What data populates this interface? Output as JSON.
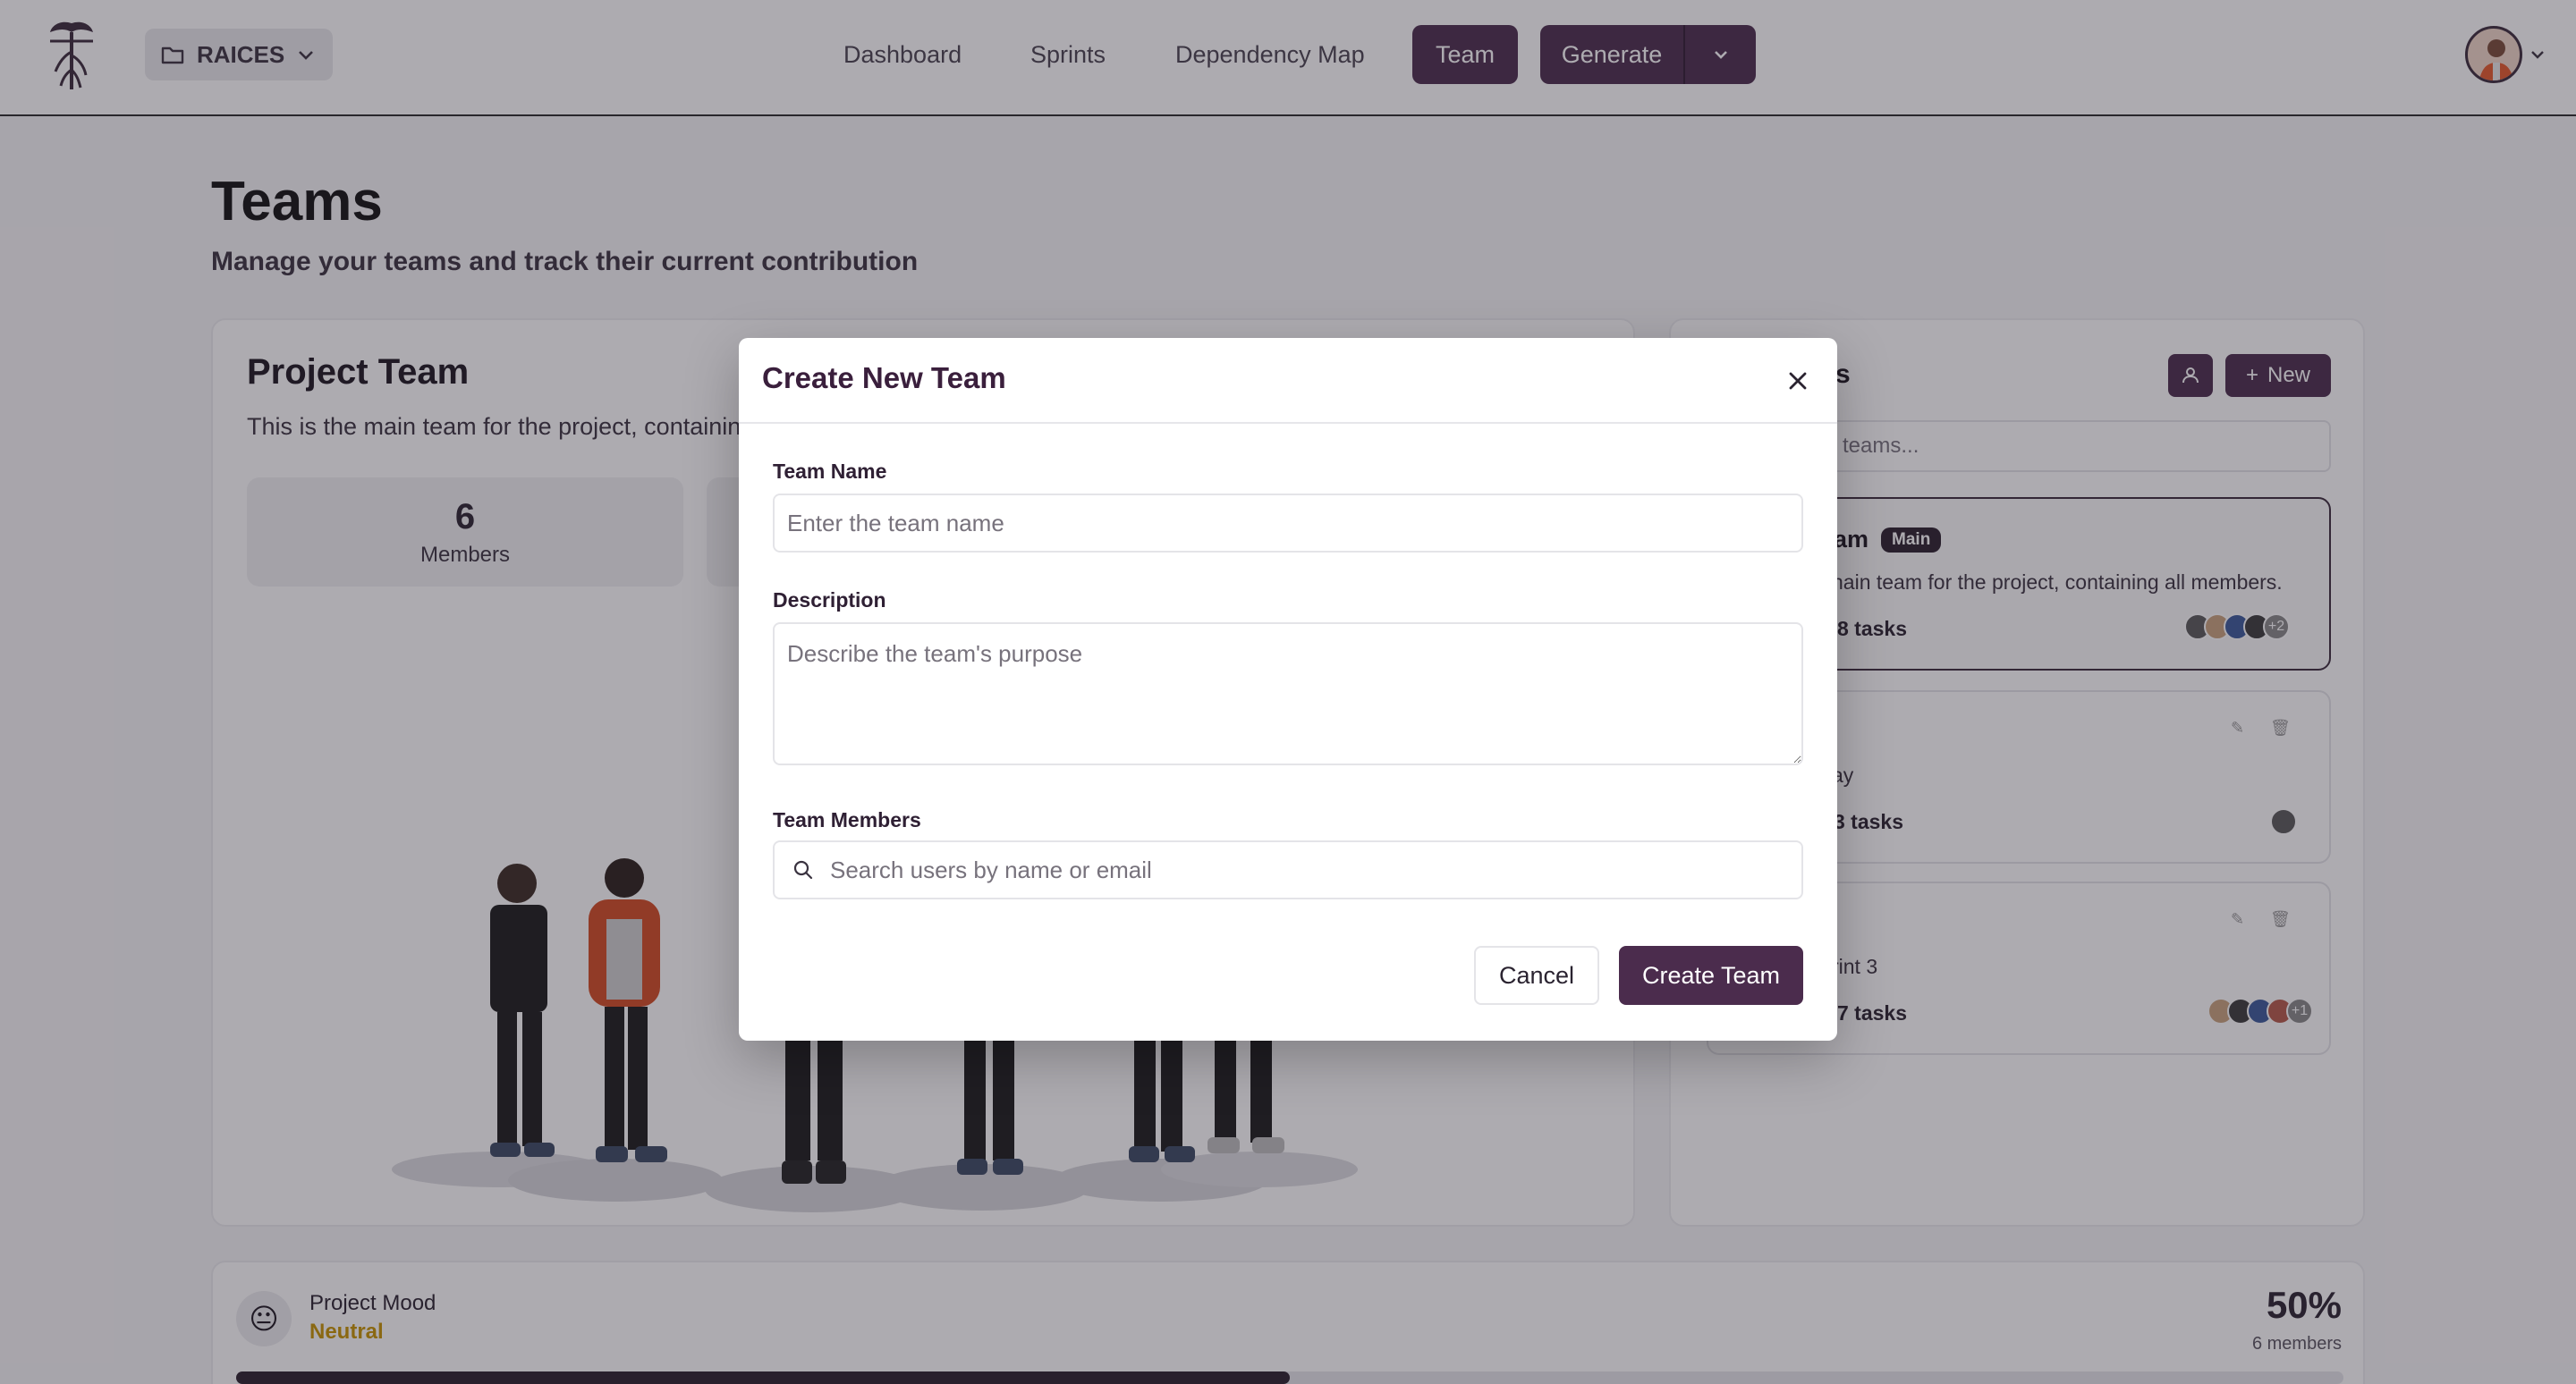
{
  "topbar": {
    "project_name": "RAICES",
    "nav": [
      "Dashboard",
      "Sprints",
      "Dependency Map"
    ],
    "team_button": "Team",
    "generate_button": "Generate"
  },
  "page": {
    "title": "Teams",
    "subtitle": "Manage your teams and track their current contribution"
  },
  "team_card": {
    "title": "Project Team",
    "description": "This is the main team for the project, containin",
    "stats": [
      {
        "value": "6",
        "label": "Members"
      }
    ]
  },
  "side_panel": {
    "title_fragment": "s",
    "new_button": "New",
    "search_placeholder": "teams...",
    "teams": [
      {
        "name_fragment": "am",
        "badge": "Main",
        "desc_fragment": "nain team for the project, containing all members.",
        "tasks": "8 tasks",
        "extra_members": "+2"
      },
      {
        "desc_fragment": "ay",
        "tasks": "3 tasks"
      },
      {
        "desc_fragment": "rint 3",
        "tasks": "7 tasks",
        "extra_members": "+1"
      }
    ]
  },
  "mood": {
    "label": "Project Mood",
    "value": "Neutral",
    "percent": "50%",
    "members": "6 members",
    "progress": 0.5,
    "accent": "#c79400"
  },
  "modal": {
    "title": "Create New Team",
    "team_name_label": "Team Name",
    "team_name_placeholder": "Enter the team name",
    "description_label": "Description",
    "description_placeholder": "Describe the team's purpose",
    "members_label": "Team Members",
    "members_placeholder": "Search users by name or email",
    "cancel_label": "Cancel",
    "create_label": "Create Team"
  },
  "colors": {
    "brand": "#4b2c4d",
    "overlay": "rgba(40,34,48,0.38)"
  }
}
